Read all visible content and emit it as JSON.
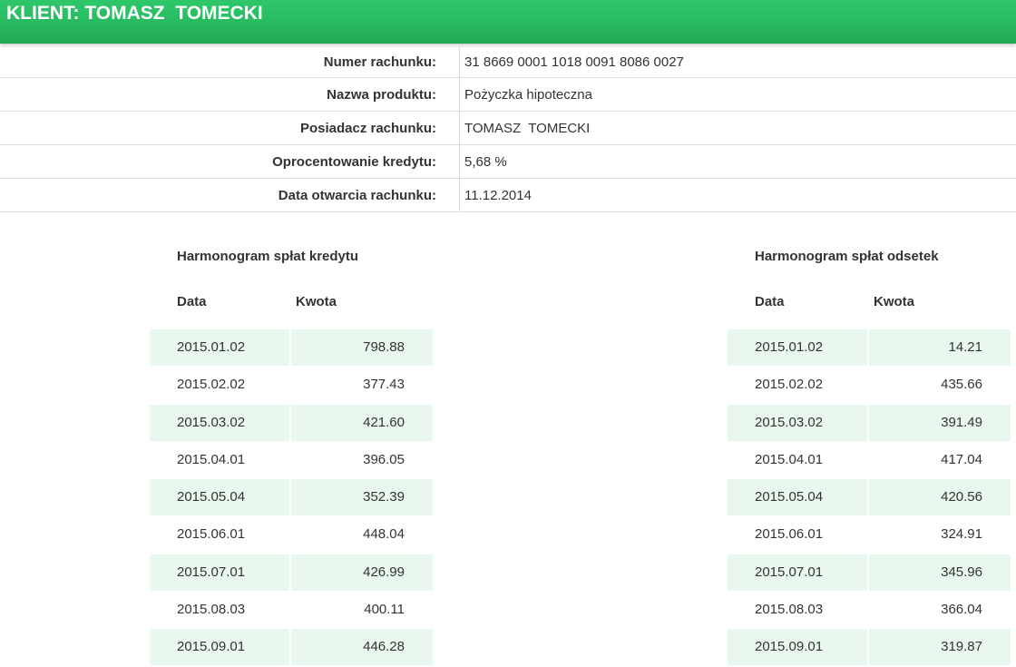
{
  "header": {
    "title": "KLIENT: TOMASZ  TOMECKI"
  },
  "account_info": [
    {
      "label": "Numer rachunku:",
      "value": "31 8669 0001 1018 0091 8086 0027"
    },
    {
      "label": "Nazwa produktu:",
      "value": "Pożyczka hipoteczna"
    },
    {
      "label": "Posiadacz rachunku:",
      "value": "TOMASZ  TOMECKI"
    },
    {
      "label": "Oprocentowanie kredytu:",
      "value": "5,68 %"
    },
    {
      "label": "Data otwarcia rachunku:",
      "value": "11.12.2014"
    }
  ],
  "credit_schedule": {
    "title": "Harmonogram spłat kredytu",
    "col_date": "Data",
    "col_amount": "Kwota",
    "rows": [
      {
        "date": "2015.01.02",
        "amount": "798.88"
      },
      {
        "date": "2015.02.02",
        "amount": "377.43"
      },
      {
        "date": "2015.03.02",
        "amount": "421.60"
      },
      {
        "date": "2015.04.01",
        "amount": "396.05"
      },
      {
        "date": "2015.05.04",
        "amount": "352.39"
      },
      {
        "date": "2015.06.01",
        "amount": "448.04"
      },
      {
        "date": "2015.07.01",
        "amount": "426.99"
      },
      {
        "date": "2015.08.03",
        "amount": "400.11"
      },
      {
        "date": "2015.09.01",
        "amount": "446.28"
      }
    ]
  },
  "interest_schedule": {
    "title": "Harmonogram spłat odsetek",
    "col_date": "Data",
    "col_amount": "Kwota",
    "rows": [
      {
        "date": "2015.01.02",
        "amount": "14.21"
      },
      {
        "date": "2015.02.02",
        "amount": "435.66"
      },
      {
        "date": "2015.03.02",
        "amount": "391.49"
      },
      {
        "date": "2015.04.01",
        "amount": "417.04"
      },
      {
        "date": "2015.05.04",
        "amount": "420.56"
      },
      {
        "date": "2015.06.01",
        "amount": "324.91"
      },
      {
        "date": "2015.07.01",
        "amount": "345.96"
      },
      {
        "date": "2015.08.03",
        "amount": "366.04"
      },
      {
        "date": "2015.09.01",
        "amount": "319.87"
      }
    ]
  },
  "colors": {
    "header_green": "#27b95f",
    "row_shade": "#e9f8ee"
  }
}
